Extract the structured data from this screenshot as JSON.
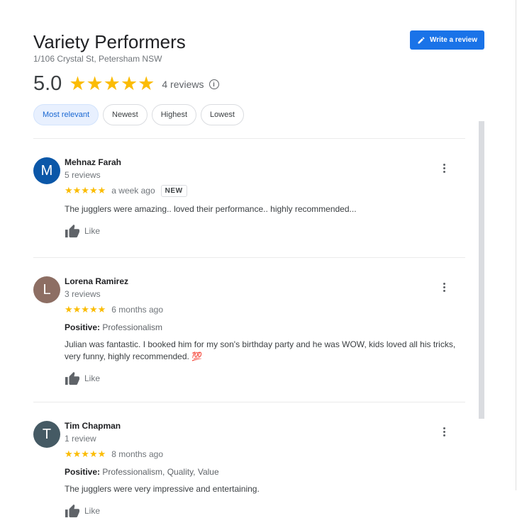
{
  "place": {
    "name": "Variety Performers",
    "address": "1/106 Crystal St, Petersham NSW",
    "rating": "5.0",
    "stars": "★★★★★",
    "review_count": "4 reviews",
    "info_glyph": "i"
  },
  "write_review": {
    "label": "Write a review"
  },
  "sort": {
    "options": [
      "Most relevant",
      "Newest",
      "Highest",
      "Lowest"
    ],
    "selected": "Most relevant"
  },
  "reviews": [
    {
      "initial": "M",
      "avatar_color": "#0b57a8",
      "name": "Mehnaz Farah",
      "sub": "5 reviews",
      "stars": "★★★★★",
      "when": "a week ago",
      "badge": "NEW",
      "text": "The jugglers were amazing.. loved their performance.. highly recommended...",
      "like": "Like"
    },
    {
      "initial": "L",
      "avatar_color": "#8d6e63",
      "name": "Lorena Ramirez",
      "sub": "3 reviews",
      "stars": "★★★★★",
      "when": "6 months ago",
      "positive_label": "Positive:",
      "positive_value": "Professionalism",
      "text": "Julian was fantastic. I booked him for my son's birthday party and he was WOW, kids loved all his tricks, very funny, highly recommended. 💯",
      "like": "Like"
    },
    {
      "initial": "T",
      "avatar_color": "#455a64",
      "name": "Tim Chapman",
      "sub": "1 review",
      "stars": "★★★★★",
      "when": "8 months ago",
      "positive_label": "Positive:",
      "positive_value": "Professionalism, Quality, Value",
      "text": "The jugglers were very impressive and entertaining.",
      "like": "Like"
    }
  ],
  "colors": {
    "accent": "#1a73e8",
    "star": "#fbbc04"
  }
}
